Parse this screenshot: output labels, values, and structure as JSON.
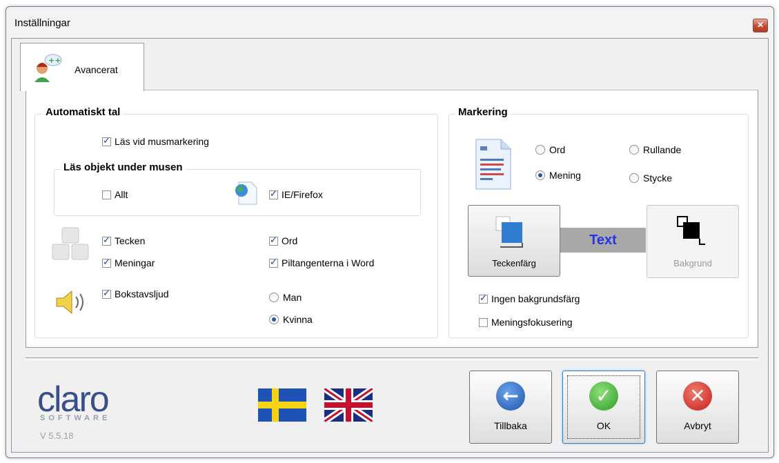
{
  "window": {
    "title": "Inställningar",
    "close_icon": "close-icon"
  },
  "tab": {
    "label": "Avancerat"
  },
  "auto_speech": {
    "title": "Automatiskt tal",
    "read_on_select": {
      "label": "Läs vid musmarkering",
      "checked": true
    },
    "read_under_mouse": {
      "title": "Läs objekt under musen",
      "all": {
        "label": "Allt",
        "checked": false
      },
      "ie_firefox": {
        "label": "IE/Firefox",
        "checked": true
      }
    },
    "characters": {
      "label": "Tecken",
      "checked": true
    },
    "sentences": {
      "label": "Meningar",
      "checked": true
    },
    "words": {
      "label": "Ord",
      "checked": true
    },
    "arrow_keys": {
      "label": "Piltangenterna i Word",
      "checked": true
    },
    "letter_sounds": {
      "label": "Bokstavsljud",
      "checked": true
    },
    "voice_man": {
      "label": "Man",
      "selected": false
    },
    "voice_woman": {
      "label": "Kvinna",
      "selected": true
    }
  },
  "marking": {
    "title": "Markering",
    "word": {
      "label": "Ord",
      "selected": false
    },
    "sentence": {
      "label": "Mening",
      "selected": true
    },
    "scrolling": {
      "label": "Rullande",
      "selected": false
    },
    "paragraph": {
      "label": "Stycke",
      "selected": false
    },
    "text_color_button": "Teckenfärg",
    "sample_text": "Text",
    "background_button": "Bakgrund",
    "no_background": {
      "label": "Ingen bakgrundsfärg",
      "checked": true
    },
    "sentence_focus": {
      "label": "Meningsfokusering",
      "checked": false
    },
    "colors": {
      "sample_bg": "#a9a9a9",
      "sample_text": "#2535e0"
    }
  },
  "footer": {
    "logo": "claro",
    "logo_sub": "SOFTWARE",
    "version": "V 5.5.18",
    "back_button": "Tillbaka",
    "ok_button": "OK",
    "cancel_button": "Avbryt"
  }
}
